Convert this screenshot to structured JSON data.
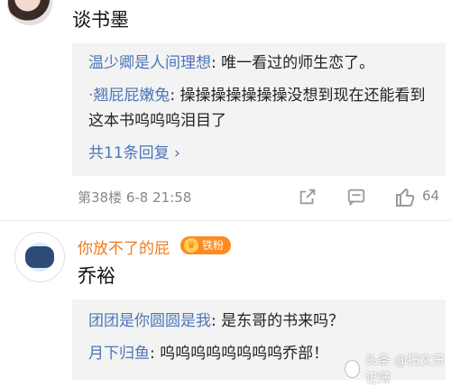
{
  "top_comment": {
    "title": "谈书墨",
    "replies": [
      {
        "user": "温少卿是人间理想",
        "text": "唯一看过的师生恋了。"
      },
      {
        "user": "·翘屁屁嫩兔",
        "text": "操操操操操操操没想到现在还能看到这本书呜呜呜泪目了"
      }
    ],
    "more_replies": "共11条回复 ›"
  },
  "comment_meta": {
    "floor_time": "第38楼 6-8 21:58",
    "like_count": "64"
  },
  "comment2": {
    "username": "你放不了的屁",
    "badge_label": "铁粉",
    "text": "乔裕",
    "replies": [
      {
        "user": "团团是你圆圆是我",
        "text": "是东哥的书来吗？"
      },
      {
        "user": "月下归鱼",
        "text": "呜呜呜呜呜呜呜呜乔部！"
      }
    ]
  },
  "watermark": {
    "text": "头条 @扫文日记薄"
  },
  "colors": {
    "link": "#4b76b8",
    "meta": "#888888",
    "reply_bg": "#f3f3f3",
    "badge": "#ff8a1f"
  },
  "icons": [
    "share-icon",
    "comment-icon",
    "like-icon"
  ]
}
